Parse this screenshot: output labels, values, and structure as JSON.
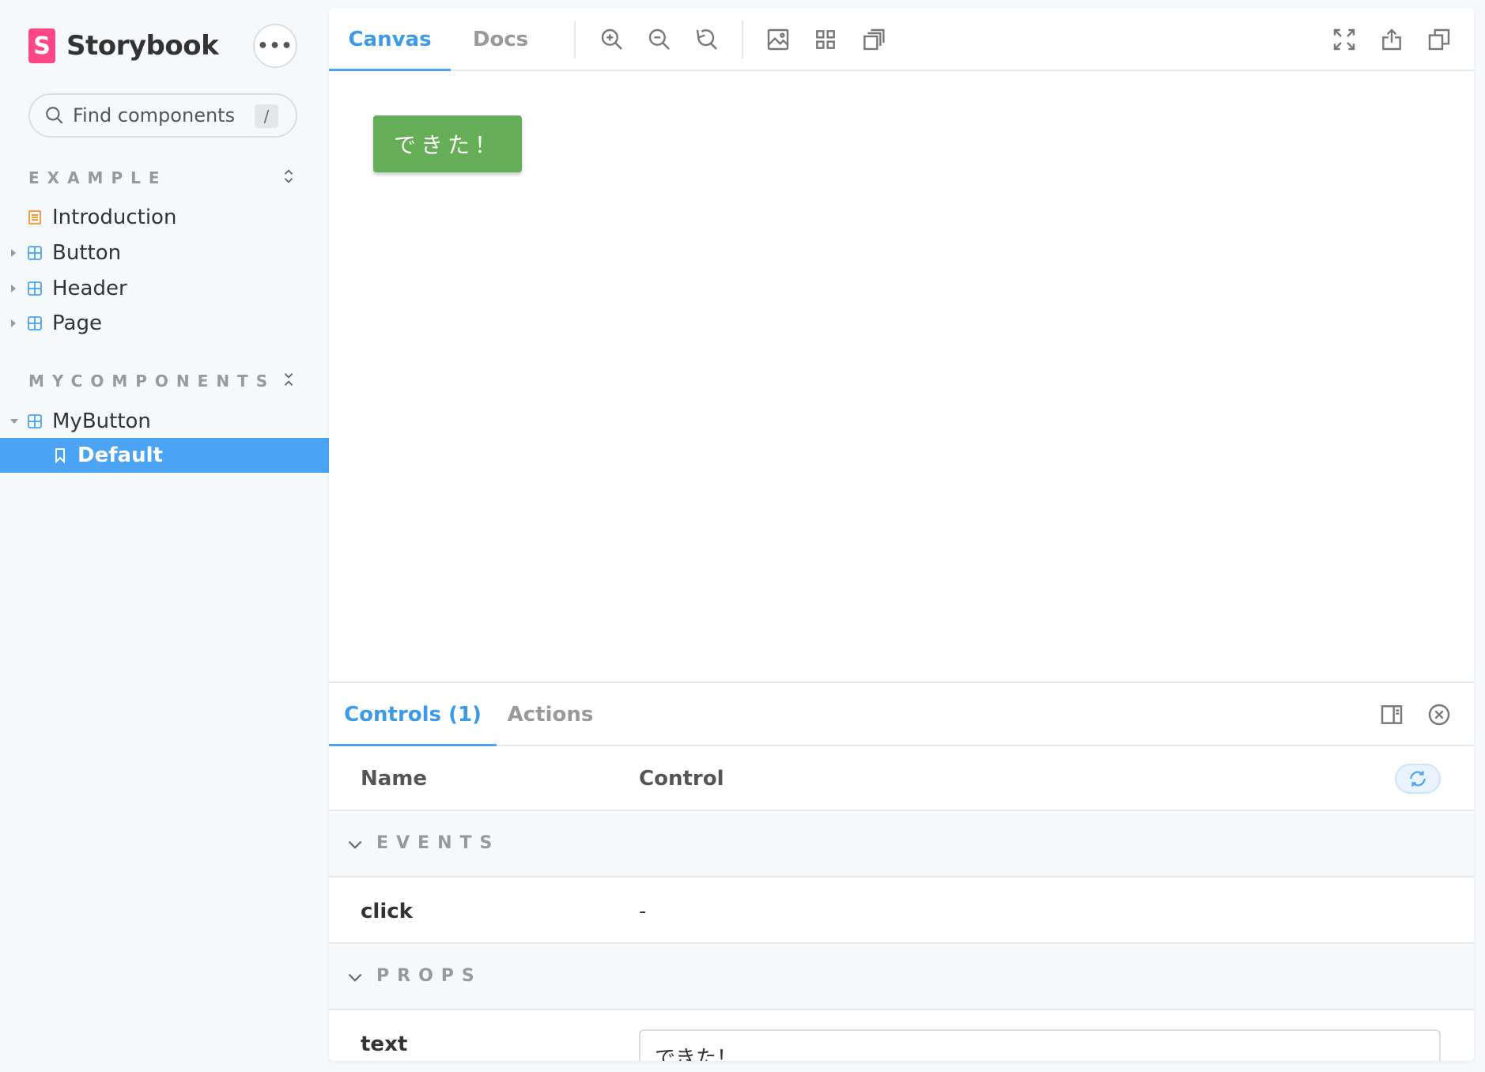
{
  "sidebar": {
    "brand": {
      "logo_letter": "S",
      "name": "Storybook"
    },
    "menu_label": "•••",
    "search": {
      "placeholder": "Find components",
      "shortcut": "/"
    },
    "groups": [
      {
        "title": "EXAMPLE",
        "items": [
          {
            "label": "Introduction",
            "icon": "document-icon"
          },
          {
            "label": "Button",
            "icon": "component-icon"
          },
          {
            "label": "Header",
            "icon": "component-icon"
          },
          {
            "label": "Page",
            "icon": "component-icon"
          }
        ]
      },
      {
        "title": "MYCOMPONENTS",
        "items": [
          {
            "label": "MyButton",
            "icon": "component-icon"
          },
          {
            "label": "Default",
            "icon": "bookmark-icon",
            "selected": true
          }
        ]
      }
    ]
  },
  "toolbar": {
    "tabs": [
      {
        "label": "Canvas",
        "active": true
      },
      {
        "label": "Docs",
        "active": false
      }
    ],
    "tools": [
      "zoom-in-icon",
      "zoom-out-icon",
      "zoom-reset-icon",
      "background-icon",
      "grid-icon",
      "measure-icon",
      "fullscreen-icon",
      "share-icon",
      "copy-icon"
    ]
  },
  "canvas": {
    "button_label": "できた！",
    "button_color": "#66ad58"
  },
  "addons": {
    "tabs": [
      {
        "label": "Controls (1)",
        "active": true
      },
      {
        "label": "Actions",
        "active": false
      }
    ],
    "table": {
      "headers": {
        "name": "Name",
        "control": "Control"
      },
      "sections": [
        {
          "title": "EVENTS",
          "rows": [
            {
              "name": "click",
              "value": "-"
            }
          ]
        },
        {
          "title": "PROPS",
          "rows": [
            {
              "name": "text",
              "value": "できた！"
            }
          ]
        }
      ]
    }
  },
  "colors": {
    "accent": "#4aa3f5",
    "brand": "#ff4785",
    "sidebar_bg": "#f6f9fc"
  }
}
